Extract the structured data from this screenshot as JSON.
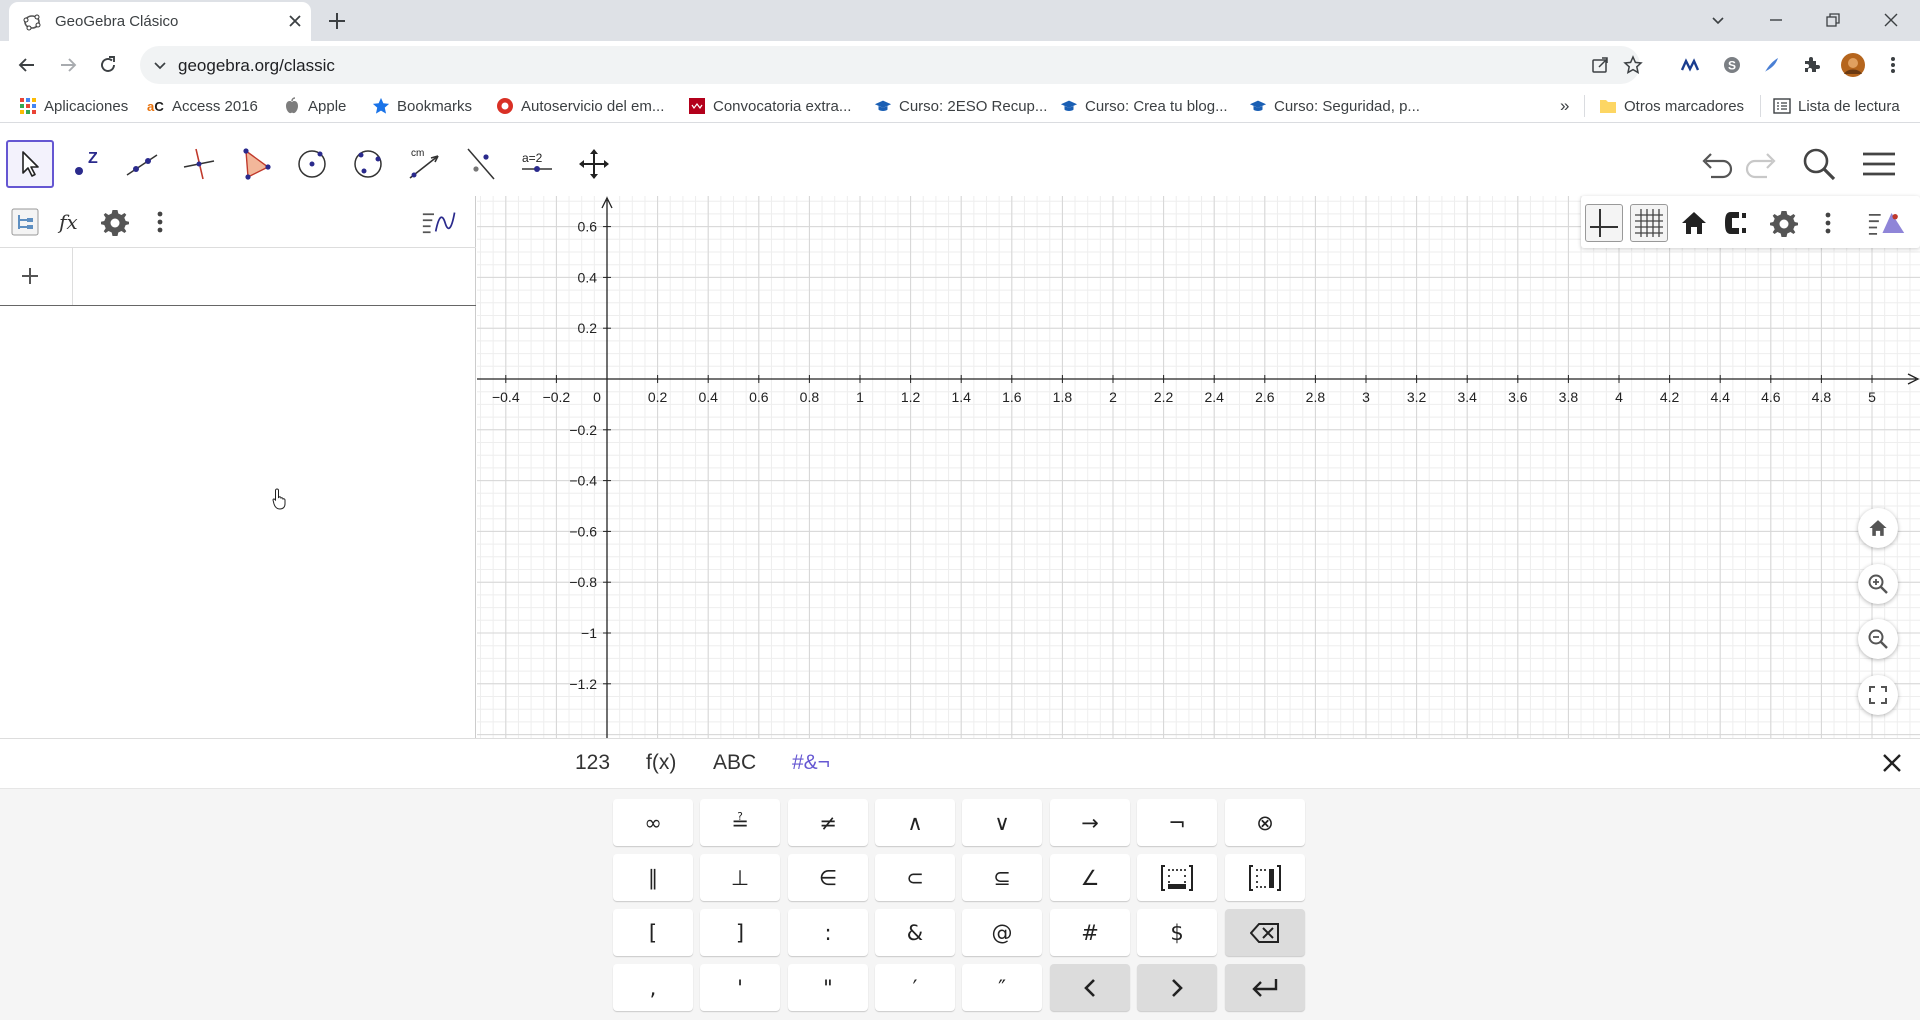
{
  "browser": {
    "tab_title": "GeoGebra Clásico",
    "url": "geogebra.org/classic",
    "bookmarks": [
      {
        "label": "Aplicaciones",
        "icon": "apps-grid-icon"
      },
      {
        "label": "Access 2016",
        "icon": "access-logo-icon"
      },
      {
        "label": "Apple",
        "icon": "apple-icon"
      },
      {
        "label": "Bookmarks",
        "icon": "star-icon"
      },
      {
        "label": "Autoservicio del em...",
        "icon": "autoservicio-icon"
      },
      {
        "label": "Convocatoria extra...",
        "icon": "convocatoria-icon"
      },
      {
        "label": "Curso: 2ESO Recup...",
        "icon": "graduation-cap-icon"
      },
      {
        "label": "Curso: Crea tu blog...",
        "icon": "graduation-cap-icon"
      },
      {
        "label": "Curso: Seguridad, p...",
        "icon": "graduation-cap-icon"
      }
    ],
    "more_bookmarks": "»",
    "other_bookmarks": "Otros marcadores",
    "reading_list": "Lista de lectura"
  },
  "graphics": {
    "x_ticks": [
      "−0.4",
      "−0.2",
      "0",
      "0.2",
      "0.4",
      "0.6",
      "0.8",
      "1",
      "1.2",
      "1.4",
      "1.6",
      "1.8",
      "2",
      "2.2",
      "2.4",
      "2.6",
      "2.8",
      "3",
      "3.2",
      "3.4",
      "3.6",
      "3.8",
      "4",
      "4.2",
      "4.4",
      "4.6",
      "4.8",
      "5"
    ],
    "y_ticks_pos": [
      "0.6",
      "0.4",
      "0.2"
    ],
    "y_ticks_neg": [
      "−0.2",
      "−0.4",
      "−0.6",
      "−0.8",
      "−1",
      "−1.2"
    ]
  },
  "keyboard": {
    "tabs": [
      "123",
      "f(x)",
      "ABC",
      "#&¬"
    ],
    "active_tab": "#&¬",
    "rows": [
      [
        "∞",
        "≟",
        "≠",
        "∧",
        "∨",
        "→",
        "¬",
        "⊗"
      ],
      [
        "∥",
        "⊥",
        "∈",
        "⊂",
        "⊆",
        "∠",
        "",
        ""
      ],
      [
        "[",
        "]",
        ":",
        "&",
        "@",
        "#",
        "$",
        ""
      ],
      [
        ",",
        "'",
        "\"",
        "′",
        "″",
        "",
        "",
        ""
      ]
    ]
  },
  "colors": {
    "accent": "#6557d2",
    "tab_strip": "#dee1e6",
    "keyboard_bg": "#f5f5f5"
  }
}
